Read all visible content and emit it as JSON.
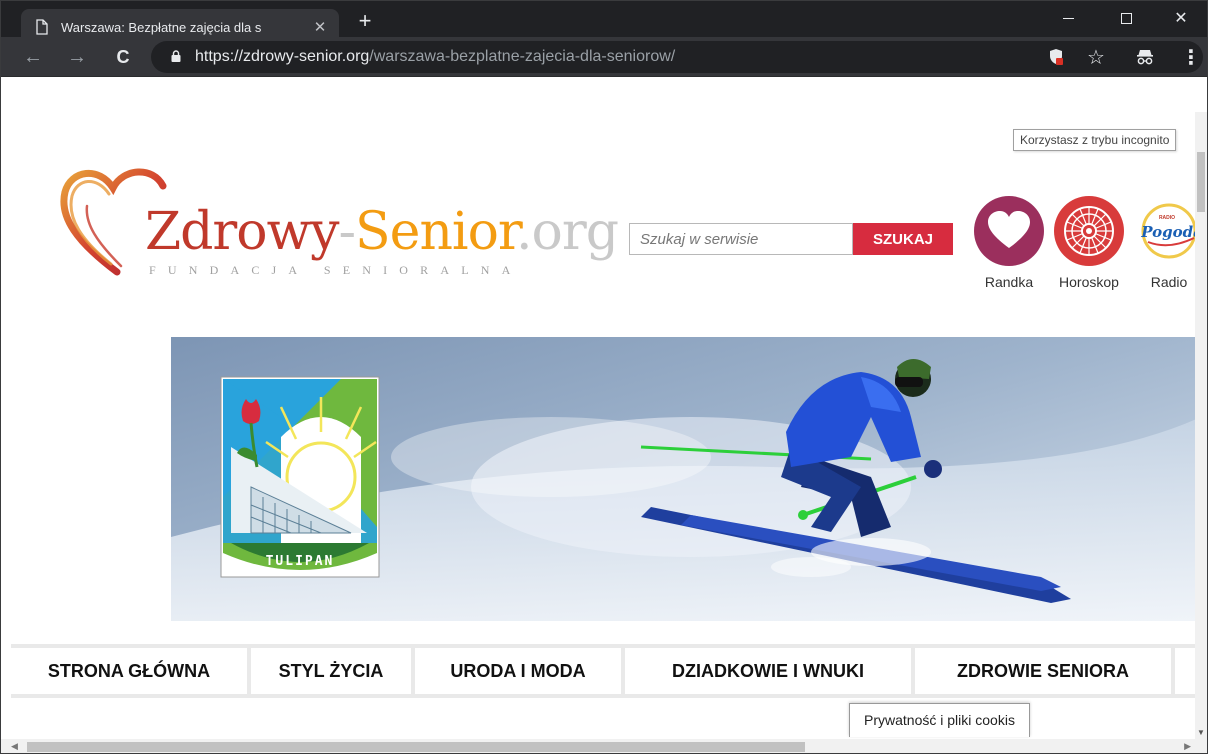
{
  "browser": {
    "tab_title": "Warszawa: Bezpłatne zajęcia dla s",
    "tab_close": "✕",
    "new_tab": "+",
    "url_host": "https://zdrowy-senior.org",
    "url_path": "/warszawa-bezplatne-zajecia-dla-seniorow/",
    "incognito_tooltip": "Korzystasz z trybu incognito",
    "icons": {
      "back": "←",
      "forward": "→",
      "reload": "C",
      "star": "☆",
      "menu": "⋮",
      "close_window": "✕"
    }
  },
  "site": {
    "logo": {
      "part1": "Zdrowy",
      "dash": "-",
      "part2": "Senior",
      "part3": ".org",
      "subtitle": "FUNDACJA SENIORALNA"
    },
    "search": {
      "placeholder": "Szukaj w serwisie",
      "button_label": "SZUKAJ"
    },
    "quick_links": [
      {
        "label": "Randka",
        "icon": "heart-icon"
      },
      {
        "label": "Horoskop",
        "icon": "zodiac-wheel-icon"
      },
      {
        "label": "Radio",
        "icon": "radio-pogoda-icon"
      }
    ],
    "radio_logo_text": "Pogoda",
    "radio_logo_small": "RADIO",
    "banner": {
      "badge_text": "TULIPAN"
    },
    "menu": [
      "STRONA GŁÓWNA",
      "STYL ŻYCIA",
      "URODA I MODA",
      "DZIADKOWIE I WNUKI",
      "ZDROWIE SENIORA"
    ],
    "cookies_label": "Prywatność i pliki cookis"
  },
  "colors": {
    "chrome_dark": "#202124",
    "chrome_toolbar": "#35363a",
    "brand_red": "#c0392b",
    "brand_orange": "#f39c12",
    "search_button": "#d72c3f"
  }
}
